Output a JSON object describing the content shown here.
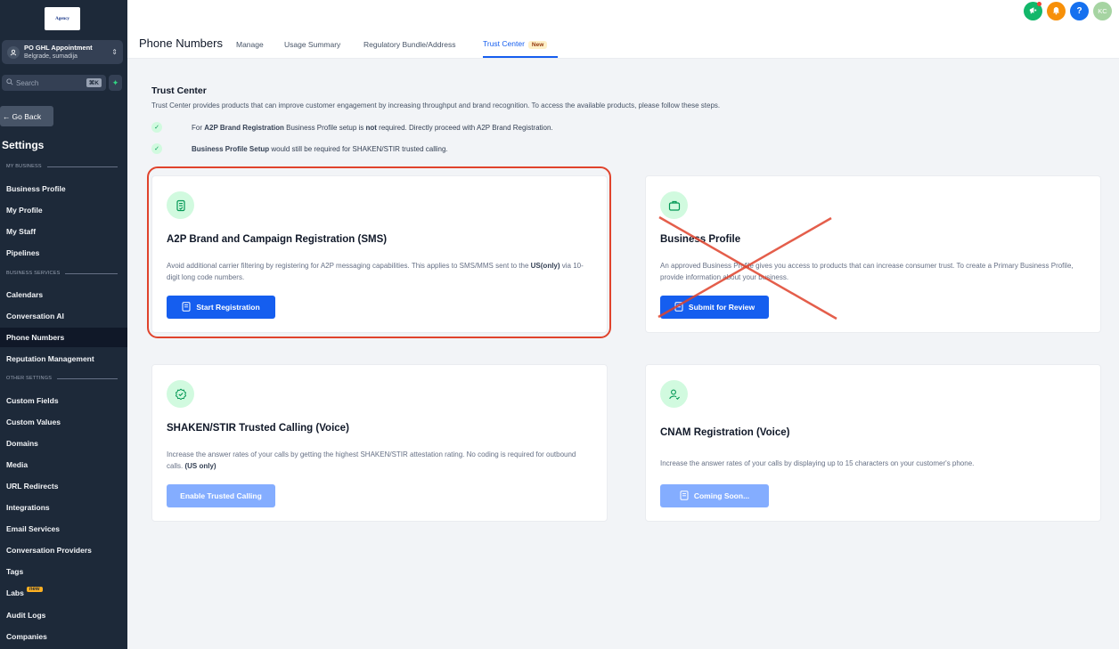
{
  "sidebar": {
    "logo_text": "Agency",
    "account": {
      "name": "PO GHL Appointment",
      "location": "Belgrade, sumadija"
    },
    "search": {
      "placeholder": "Search",
      "shortcut": "⌘K"
    },
    "go_back": "Go Back",
    "settings_title": "Settings",
    "sections": {
      "my_business": "MY BUSINESS",
      "business_services": "BUSINESS SERVICES",
      "other_settings": "OTHER SETTINGS"
    },
    "items": {
      "business_profile": "Business Profile",
      "my_profile": "My Profile",
      "my_staff": "My Staff",
      "pipelines": "Pipelines",
      "calendars": "Calendars",
      "conversation_ai": "Conversation AI",
      "phone_numbers": "Phone Numbers",
      "reputation_management": "Reputation Management",
      "custom_fields": "Custom Fields",
      "custom_values": "Custom Values",
      "domains": "Domains",
      "media": "Media",
      "url_redirects": "URL Redirects",
      "integrations": "Integrations",
      "email_services": "Email Services",
      "conversation_providers": "Conversation Providers",
      "tags": "Tags",
      "labs": "Labs",
      "labs_badge": "new",
      "audit_logs": "Audit Logs",
      "companies": "Companies"
    }
  },
  "header": {
    "user_initials": "KC",
    "help": "?"
  },
  "subnav": {
    "title": "Phone Numbers",
    "tabs": {
      "manage": "Manage",
      "usage_summary": "Usage Summary",
      "regulatory": "Regulatory Bundle/Address",
      "trust_center": "Trust Center",
      "trust_center_badge": "New"
    }
  },
  "main": {
    "title": "Trust Center",
    "description": "Trust Center provides products that can improve customer engagement by increasing throughput and brand recognition. To access the available products, please follow these steps.",
    "steps": [
      {
        "pre": "For ",
        "bold1": "A2P Brand Registration",
        "mid": " Business Profile setup is ",
        "bold2": "not",
        "post": " required. Directly proceed with A2P Brand Registration."
      },
      {
        "bold1": "Business Profile Setup",
        "post": " would still be required for SHAKEN/STIR trusted calling."
      }
    ],
    "cards": {
      "a2p": {
        "title": "A2P Brand and Campaign Registration (SMS)",
        "desc_pre": "Avoid additional carrier filtering by registering for A2P messaging capabilities. This applies to SMS/MMS sent to the ",
        "desc_bold": "US(only)",
        "desc_post": " via 10-digit long code numbers.",
        "button": "Start Registration"
      },
      "business_profile": {
        "title": "Business Profile",
        "desc": "An approved Business Profile gives you access to products that can increase consumer trust. To create a Primary Business Profile, provide information about your business.",
        "button": "Submit for Review"
      },
      "shaken": {
        "title": "SHAKEN/STIR Trusted Calling (Voice)",
        "desc_pre": "Increase the answer rates of your calls by getting the highest SHAKEN/STIR attestation rating. No coding is required for outbound calls. ",
        "desc_bold": "(US only)",
        "button": "Enable Trusted Calling"
      },
      "cnam": {
        "title": "CNAM Registration (Voice)",
        "desc": "Increase the answer rates of your calls by displaying up to 15 characters on your customer's phone.",
        "button": "Coming Soon..."
      }
    }
  },
  "colors": {
    "sidebar_bg": "#1d2939",
    "primary": "#155eef",
    "highlight_border": "#e0432c",
    "success_bg": "#d1fadf"
  }
}
